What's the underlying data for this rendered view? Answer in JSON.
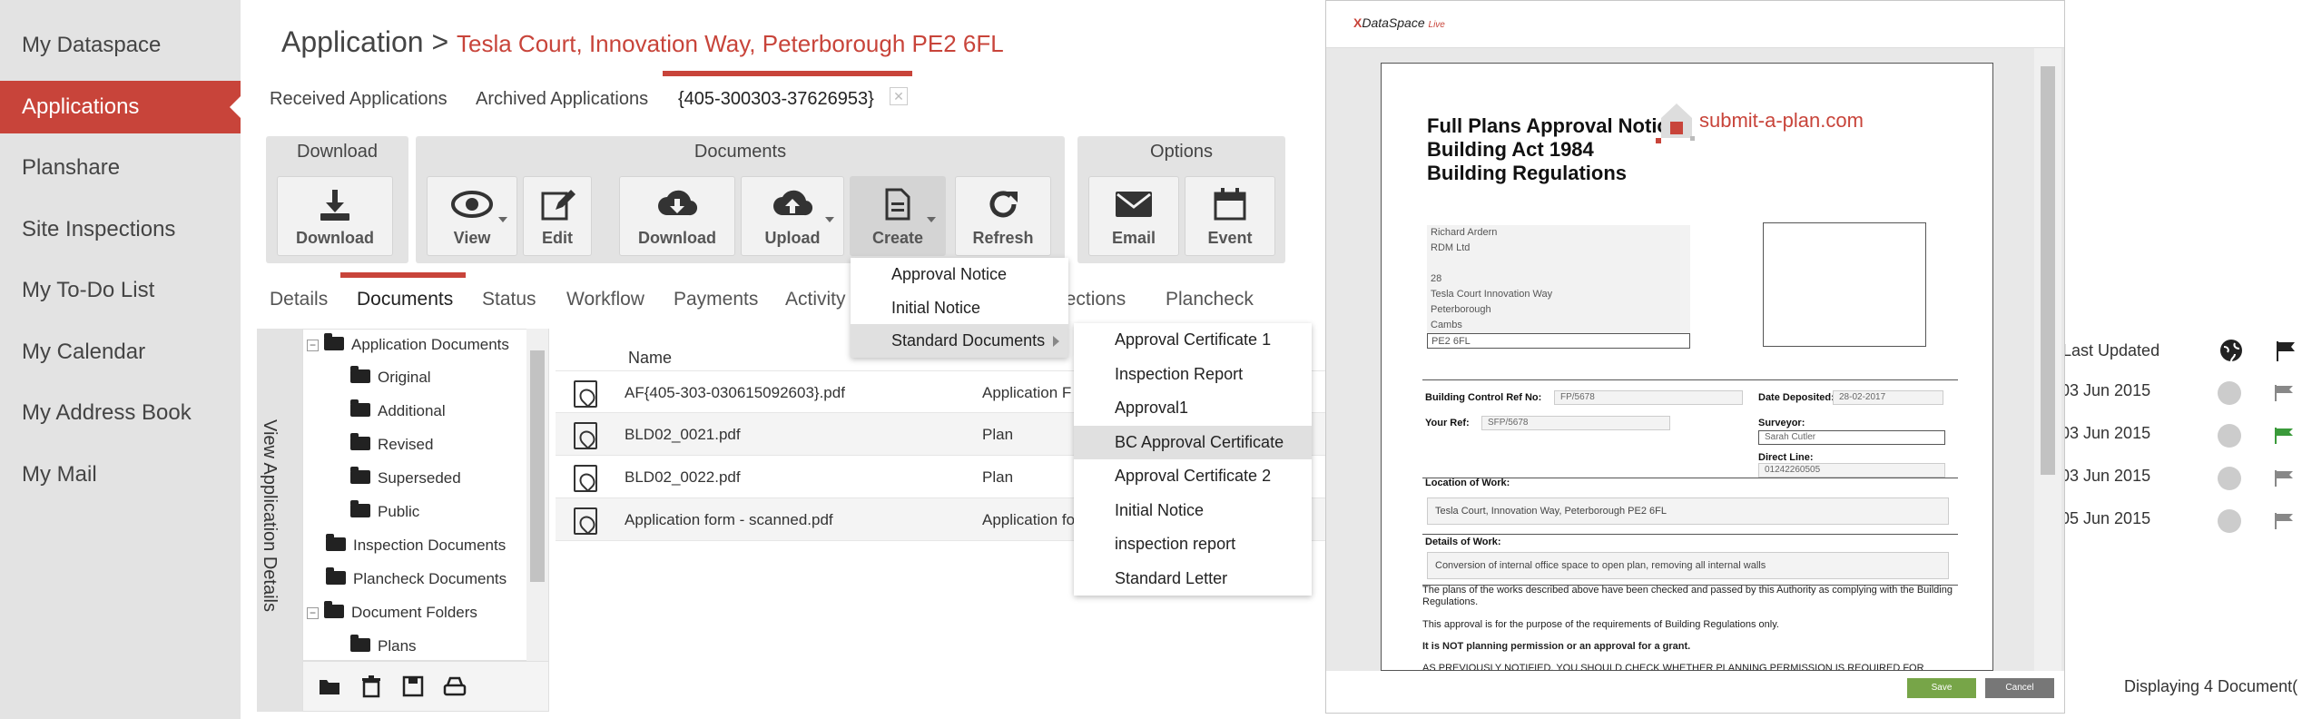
{
  "sidebar": {
    "items": [
      {
        "label": "My Dataspace"
      },
      {
        "label": "Applications"
      },
      {
        "label": "Planshare"
      },
      {
        "label": "Site Inspections"
      },
      {
        "label": "My To-Do List"
      },
      {
        "label": "My Calendar"
      },
      {
        "label": "My Address Book"
      },
      {
        "label": "My Mail"
      }
    ],
    "active": "Applications"
  },
  "header": {
    "title": "Application",
    "separator": ">",
    "crumb": "Tesla Court, Innovation Way, Peterborough PE2 6FL"
  },
  "top_tabs": [
    "Received Applications",
    "Archived Applications",
    "{405-300303-37626953}"
  ],
  "toolbar": {
    "download_group": {
      "title": "Download",
      "buttons": [
        "Download"
      ]
    },
    "documents_group": {
      "title": "Documents",
      "buttons": [
        "View",
        "Edit",
        "Download",
        "Upload",
        "Create",
        "Refresh"
      ]
    },
    "options_group": {
      "title": "Options",
      "buttons": [
        "Email",
        "Event"
      ]
    }
  },
  "sub_tabs": [
    "Details",
    "Documents",
    "Status",
    "Workflow",
    "Payments",
    "Activity",
    "pections",
    "Plancheck"
  ],
  "side_panel_label": "View Application Details",
  "tree": [
    {
      "label": "Application Documents"
    },
    {
      "label": "Original"
    },
    {
      "label": "Additional"
    },
    {
      "label": "Revised"
    },
    {
      "label": "Superseded"
    },
    {
      "label": "Public"
    },
    {
      "label": "Inspection Documents"
    },
    {
      "label": "Plancheck Documents"
    },
    {
      "label": "Document Folders"
    },
    {
      "label": "Plans"
    }
  ],
  "table": {
    "headers": {
      "name": "Name",
      "last_updated": "Last Updated"
    },
    "rows": [
      {
        "name": "AF{405-303-030615092603}.pdf",
        "type": "Application F",
        "updated": "03 Jun 2015"
      },
      {
        "name": "BLD02_0021.pdf",
        "type": "Plan",
        "updated": "03 Jun 2015"
      },
      {
        "name": "BLD02_0022.pdf",
        "type": "Plan",
        "updated": "03 Jun 2015"
      },
      {
        "name": "Application form - scanned.pdf",
        "type": "Application fo",
        "updated": "05 Jun 2015"
      }
    ],
    "footer": "Displaying 4 Document("
  },
  "create_menu": [
    "Approval Notice",
    "Initial Notice",
    "Standard Documents"
  ],
  "standard_documents_menu": [
    "Approval Certificate 1",
    "Inspection Report",
    "Approval1",
    "BC Approval Certificate",
    "Approval Certificate 2",
    "Initial Notice",
    "inspection report",
    "Standard Letter"
  ],
  "highlighted_item": "BC Approval Certificate",
  "preview": {
    "logo": {
      "x": "X",
      "text": "DataSpace",
      "sub": "Live"
    },
    "doc_title": [
      "Full Plans Approval Notice",
      "Building Act 1984",
      "Building Regulations"
    ],
    "brand": "submit-a-plan.com",
    "address": [
      "Richard Ardern",
      "RDM Ltd",
      "",
      "28",
      "Tesla Court Innovation Way",
      "Peterborough",
      "Cambs",
      "PE2 6FL"
    ],
    "fields": {
      "bc_ref_label": "Building Control Ref No:",
      "bc_ref": "FP/5678",
      "date_label": "Date Deposited:",
      "date": "28-02-2017",
      "your_ref_label": "Your Ref:",
      "your_ref": "SFP/5678",
      "surveyor_label": "Surveyor:",
      "surveyor": "Sarah Cutler",
      "direct_line_label": "Direct Line:",
      "direct_line": "01242260505",
      "location_label": "Location of Work:",
      "location": "Tesla Court, Innovation Way,  Peterborough  PE2 6FL",
      "details_label": "Details of Work:",
      "details": "Conversion of internal office space to open plan, removing all internal walls"
    },
    "paragraphs": [
      "The plans of the works described above have been checked and passed by this Authority as complying with the Building Regulations.",
      "This approval is for the purpose of the requirements of Building Regulations only.",
      "It is NOT planning permission or an approval for a grant.",
      "AS PREVIOUSLY NOTIFIED, YOU SHOULD CHECK WHETHER PLANNING PERMISSION IS REQUIRED FOR"
    ],
    "save_label": "Save",
    "cancel_label": "Cancel"
  },
  "colors": {
    "accent": "#c8443a",
    "save": "#77a548"
  }
}
